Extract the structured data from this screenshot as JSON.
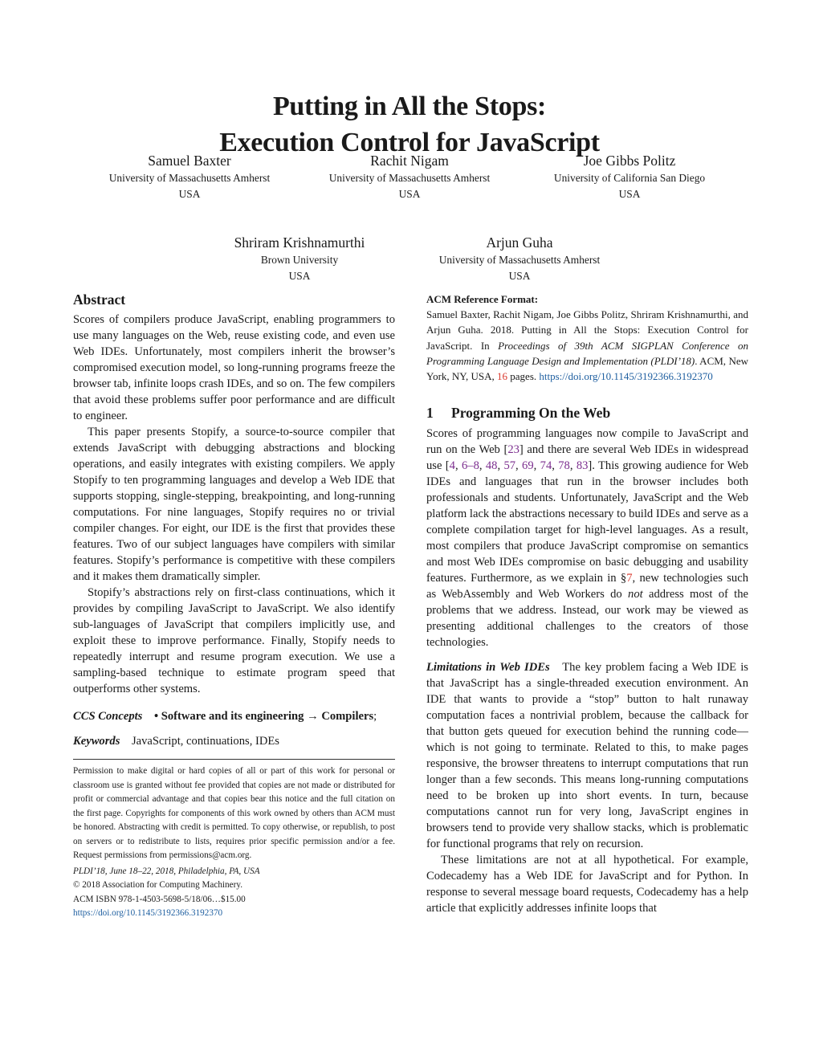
{
  "title": {
    "line1": "Putting in All the Stops:",
    "line2": "Execution Control for JavaScript"
  },
  "authors": [
    {
      "name": "Samuel Baxter",
      "affiliation": "University of Massachusetts Amherst",
      "country": "USA"
    },
    {
      "name": "Rachit Nigam",
      "affiliation": "University of Massachusetts Amherst",
      "country": "USA"
    },
    {
      "name": "Joe Gibbs Politz",
      "affiliation": "University of California San Diego",
      "country": "USA"
    },
    {
      "name": "Shriram Krishnamurthi",
      "affiliation": "Brown University",
      "country": "USA"
    },
    {
      "name": "Arjun Guha",
      "affiliation": "University of Massachusetts Amherst",
      "country": "USA"
    }
  ],
  "abstract": {
    "heading": "Abstract",
    "paragraphs": [
      "Scores of compilers produce JavaScript, enabling programmers to use many languages on the Web, reuse existing code, and even use Web IDEs. Unfortunately, most compilers inherit the browser’s compromised execution model, so long-running programs freeze the browser tab, infinite loops crash IDEs, and so on. The few compilers that avoid these problems suffer poor performance and are difficult to engineer.",
      "This paper presents Stopify, a source-to-source compiler that extends JavaScript with debugging abstractions and blocking operations, and easily integrates with existing compilers. We apply Stopify to ten programming languages and develop a Web IDE that supports stopping, single-stepping, breakpointing, and long-running computations. For nine languages, Stopify requires no or trivial compiler changes. For eight, our IDE is the first that provides these features. Two of our subject languages have compilers with similar features. Stopify’s performance is competitive with these compilers and it makes them dramatically simpler.",
      "Stopify’s abstractions rely on first-class continuations, which it provides by compiling JavaScript to JavaScript. We also identify sub-languages of JavaScript that compilers implicitly use, and exploit these to improve performance. Finally, Stopify needs to repeatedly interrupt and resume program execution. We use a sampling-based technique to estimate program speed that outperforms other systems."
    ]
  },
  "ccs": {
    "label": "CCS Concepts",
    "bullet": "•",
    "concept": "Software and its engineering → Compilers",
    "suffix": ";"
  },
  "keywords": {
    "label": "Keywords",
    "value": "JavaScript, continuations, IDEs"
  },
  "footnote": {
    "permission": "Permission to make digital or hard copies of all or part of this work for personal or classroom use is granted without fee provided that copies are not made or distributed for profit or commercial advantage and that copies bear this notice and the full citation on the first page. Copyrights for components of this work owned by others than ACM must be honored. Abstracting with credit is permitted. To copy otherwise, or republish, to post on servers or to redistribute to lists, requires prior specific permission and/or a fee. Request permissions from permissions@acm.org.",
    "venue": "PLDI’18, June 18–22, 2018, Philadelphia, PA, USA",
    "copyright": "© 2018 Association for Computing Machinery.",
    "isbn": "ACM ISBN 978-1-4503-5698-5/18/06…$15.00",
    "doi": "https://doi.org/10.1145/3192366.3192370"
  },
  "acm_reference": {
    "heading": "ACM Reference Format:",
    "text_before": "Samuel Baxter, Rachit Nigam, Joe Gibbs Politz, Shriram Krishnamurthi, and Arjun Guha. 2018. Putting in All the Stops: Execution Control for JavaScript. In ",
    "proceedings": "Proceedings of 39th ACM SIGPLAN Conference on Programming Language Design and Implementation (PLDI’18)",
    "text_middle": ". ACM, New York, NY, USA, ",
    "pages": "16",
    "text_after": " pages. ",
    "doi": "https://doi.org/10.1145/3192366.3192370"
  },
  "section1": {
    "number": "1",
    "title": "Programming On the Web",
    "p1": {
      "a": "Scores of programming languages now compile to JavaScript and run on the Web [",
      "cite1": "23",
      "b": "] and there are several Web IDEs in widespread use [",
      "cites": [
        "4",
        "6–8",
        "48",
        "57",
        "69",
        "74",
        "78",
        "83"
      ],
      "c": "]. This growing audience for Web IDEs and languages that run in the browser includes both professionals and students. Unfortunately, JavaScript and the Web platform lack the abstractions necessary to build IDEs and serve as a complete compilation target for high-level languages. As a result, most compilers that produce JavaScript compromise on semantics and most Web IDEs compromise on basic debugging and usability features. Furthermore, as we explain in §",
      "secref": "7",
      "d": ", new technologies such as WebAssembly and Web Workers do ",
      "emph": "not",
      "e": " address most of the problems that we address. Instead, our work may be viewed as presenting additional challenges to the creators of those technologies."
    },
    "limitations": {
      "heading": "Limitations in Web IDEs",
      "text": "The key problem facing a Web IDE is that JavaScript has a single-threaded execution environment. An IDE that wants to provide a “stop” button to halt runaway computation faces a nontrivial problem, because the callback for that button gets queued for execution behind the running code—which is not going to terminate. Related to this, to make pages responsive, the browser threatens to interrupt computations that run longer than a few seconds. This means long-running computations need to be broken up into short events. In turn, because computations cannot run for very long, JavaScript engines in browsers tend to provide very shallow stacks, which is problematic for functional programs that rely on recursion."
    },
    "p3": "These limitations are not at all hypothetical. For example, Codecademy has a Web IDE for JavaScript and for Python. In response to several message board requests, Codecademy has a help article that explicitly addresses infinite loops that"
  },
  "colors": {
    "link": "#1f5fa0",
    "citation": "#7b2d8e",
    "reference": "#d9362b"
  }
}
